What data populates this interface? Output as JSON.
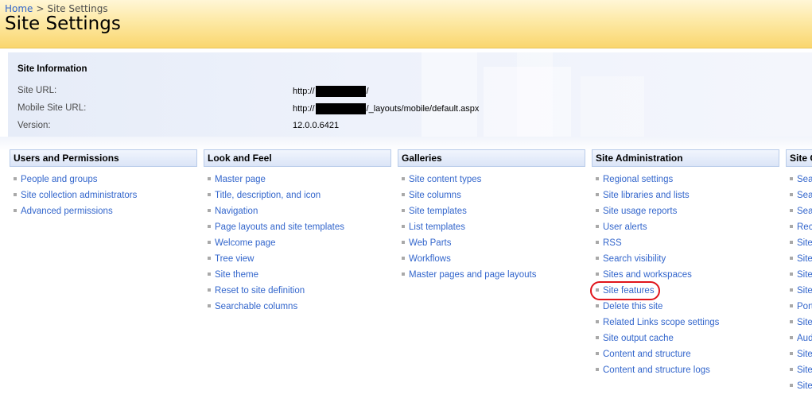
{
  "breadcrumb": {
    "home": "Home",
    "separator": ">",
    "current": "Site Settings"
  },
  "page_title": "Site Settings",
  "site_info": {
    "title": "Site Information",
    "site_url_label": "Site URL:",
    "site_url_prefix": "http://",
    "site_url_suffix": "/",
    "mobile_url_label": "Mobile Site URL:",
    "mobile_url_prefix": "http://",
    "mobile_url_suffix": "/_layouts/mobile/default.aspx",
    "version_label": "Version:",
    "version_value": "12.0.0.6421"
  },
  "colors": {
    "link": "#3366cc",
    "header_border": "#b8cbe9",
    "highlight": "#e0141b",
    "title_bar": "#fad66e"
  },
  "columns": [
    {
      "title": "Users and Permissions",
      "items": [
        "People and groups",
        "Site collection administrators",
        "Advanced permissions"
      ]
    },
    {
      "title": "Look and Feel",
      "items": [
        "Master page",
        "Title, description, and icon",
        "Navigation",
        "Page layouts and site templates",
        "Welcome page",
        "Tree view",
        "Site theme",
        "Reset to site definition",
        "Searchable columns"
      ]
    },
    {
      "title": "Galleries",
      "items": [
        "Site content types",
        "Site columns",
        "Site templates",
        "List templates",
        "Web Parts",
        "Workflows",
        "Master pages and page layouts"
      ]
    },
    {
      "title": "Site Administration",
      "items": [
        "Regional settings",
        "Site libraries and lists",
        "Site usage reports",
        "User alerts",
        "RSS",
        "Search visibility",
        "Sites and workspaces",
        "Site features",
        "Delete this site",
        "Related Links scope settings",
        "Site output cache",
        "Content and structure",
        "Content and structure logs"
      ]
    },
    {
      "title": "Site C",
      "items": [
        "Sea",
        "Sea",
        "Sea",
        "Rec",
        "Site",
        "Site",
        "Site",
        "Site",
        "Port",
        "Site",
        "Aud",
        "Site",
        "Site",
        "Site"
      ]
    }
  ]
}
